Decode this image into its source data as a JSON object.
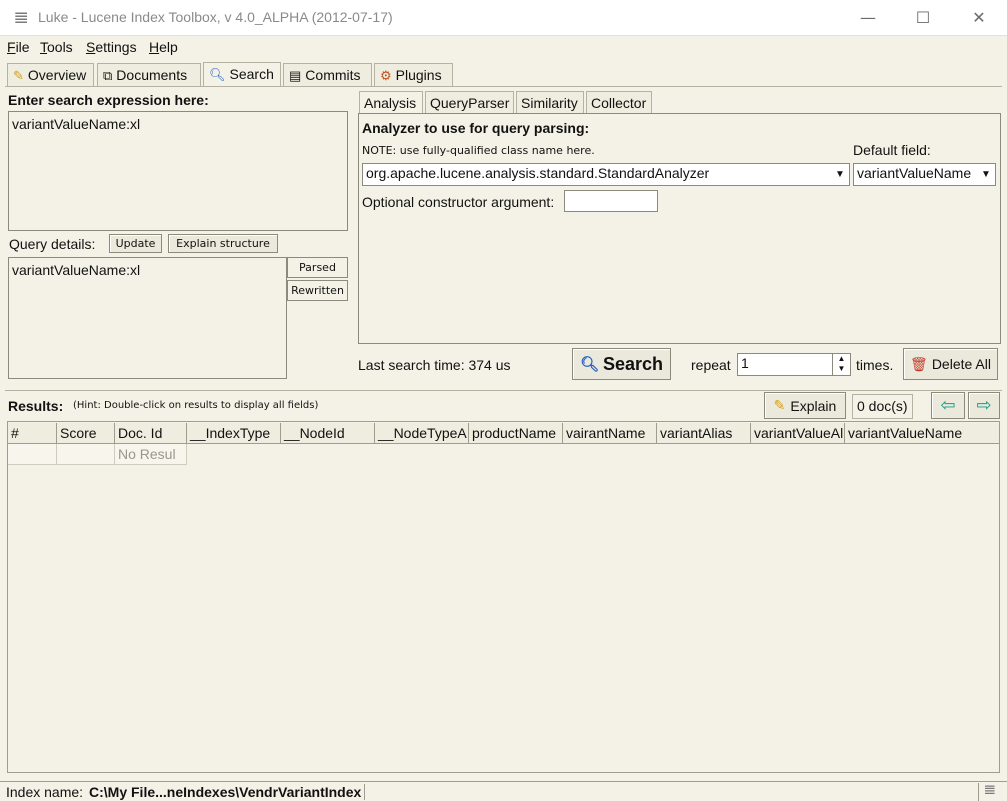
{
  "window": {
    "title": "Luke - Lucene Index Toolbox, v 4.0_ALPHA (2012-07-17)",
    "minimize_glyph": "—",
    "maximize_glyph": "☐",
    "close_glyph": "✕"
  },
  "menu": {
    "file": {
      "accel": "F",
      "rest": "ile"
    },
    "tools": {
      "accel": "T",
      "rest": "ools"
    },
    "settings": {
      "accel": "S",
      "rest": "ettings"
    },
    "help": {
      "accel": "H",
      "rest": "elp"
    }
  },
  "main_tabs": [
    {
      "label": "Overview",
      "icon": "overview-icon"
    },
    {
      "label": "Documents",
      "icon": "documents-icon"
    },
    {
      "label": "Search",
      "icon": "search-icon"
    },
    {
      "label": "Commits",
      "icon": "commits-icon"
    },
    {
      "label": "Plugins",
      "icon": "plugins-icon"
    }
  ],
  "search": {
    "expression_label": "Enter search expression here:",
    "expression_value": "variantValueName:xl",
    "query_details_label": "Query details:",
    "update_button": "Update",
    "explain_structure_button": "Explain structure",
    "query_details_value": "variantValueName:xl",
    "parsed_tab": "Parsed",
    "rewritten_tab": "Rewritten",
    "last_search_time": "Last search time: 374 us",
    "search_button": "Search",
    "repeat_label": "repeat",
    "repeat_value": "1",
    "times_label": "times.",
    "delete_all_button": "Delete All"
  },
  "analysis": {
    "tabs": [
      "Analysis",
      "QueryParser",
      "Similarity",
      "Collector"
    ],
    "analyzer_heading": "Analyzer to use for query parsing:",
    "note": "NOTE: use fully-qualified class name here.",
    "default_field_label": "Default field:",
    "analyzer_value": "org.apache.lucene.analysis.standard.StandardAnalyzer",
    "default_field_value": "variantValueName",
    "constructor_label": "Optional constructor argument:",
    "constructor_value": ""
  },
  "results": {
    "label": "Results:",
    "hint": "(Hint: Double-click on results to display all fields)",
    "explain_button": "Explain",
    "doc_count": "0 doc(s)",
    "prev_glyph": "⇦",
    "next_glyph": "⇨",
    "columns": [
      "#",
      "Score",
      "Doc. Id",
      "__IndexType",
      "__NodeId",
      "__NodeTypeA",
      "productName",
      "vairantName",
      "variantAlias",
      "variantValueAl",
      "variantValueName"
    ],
    "no_results": "No Resul"
  },
  "status": {
    "index_label": "Index name:",
    "index_value": "C:\\My File...neIndexes\\VendrVariantIndex"
  },
  "colors": {
    "background": "#f4f2e6",
    "search_icon": "#2a62c0",
    "arrow": "#1a9a8a",
    "delete_icon": "#c03a2a",
    "explain_icon": "#d4a020"
  }
}
